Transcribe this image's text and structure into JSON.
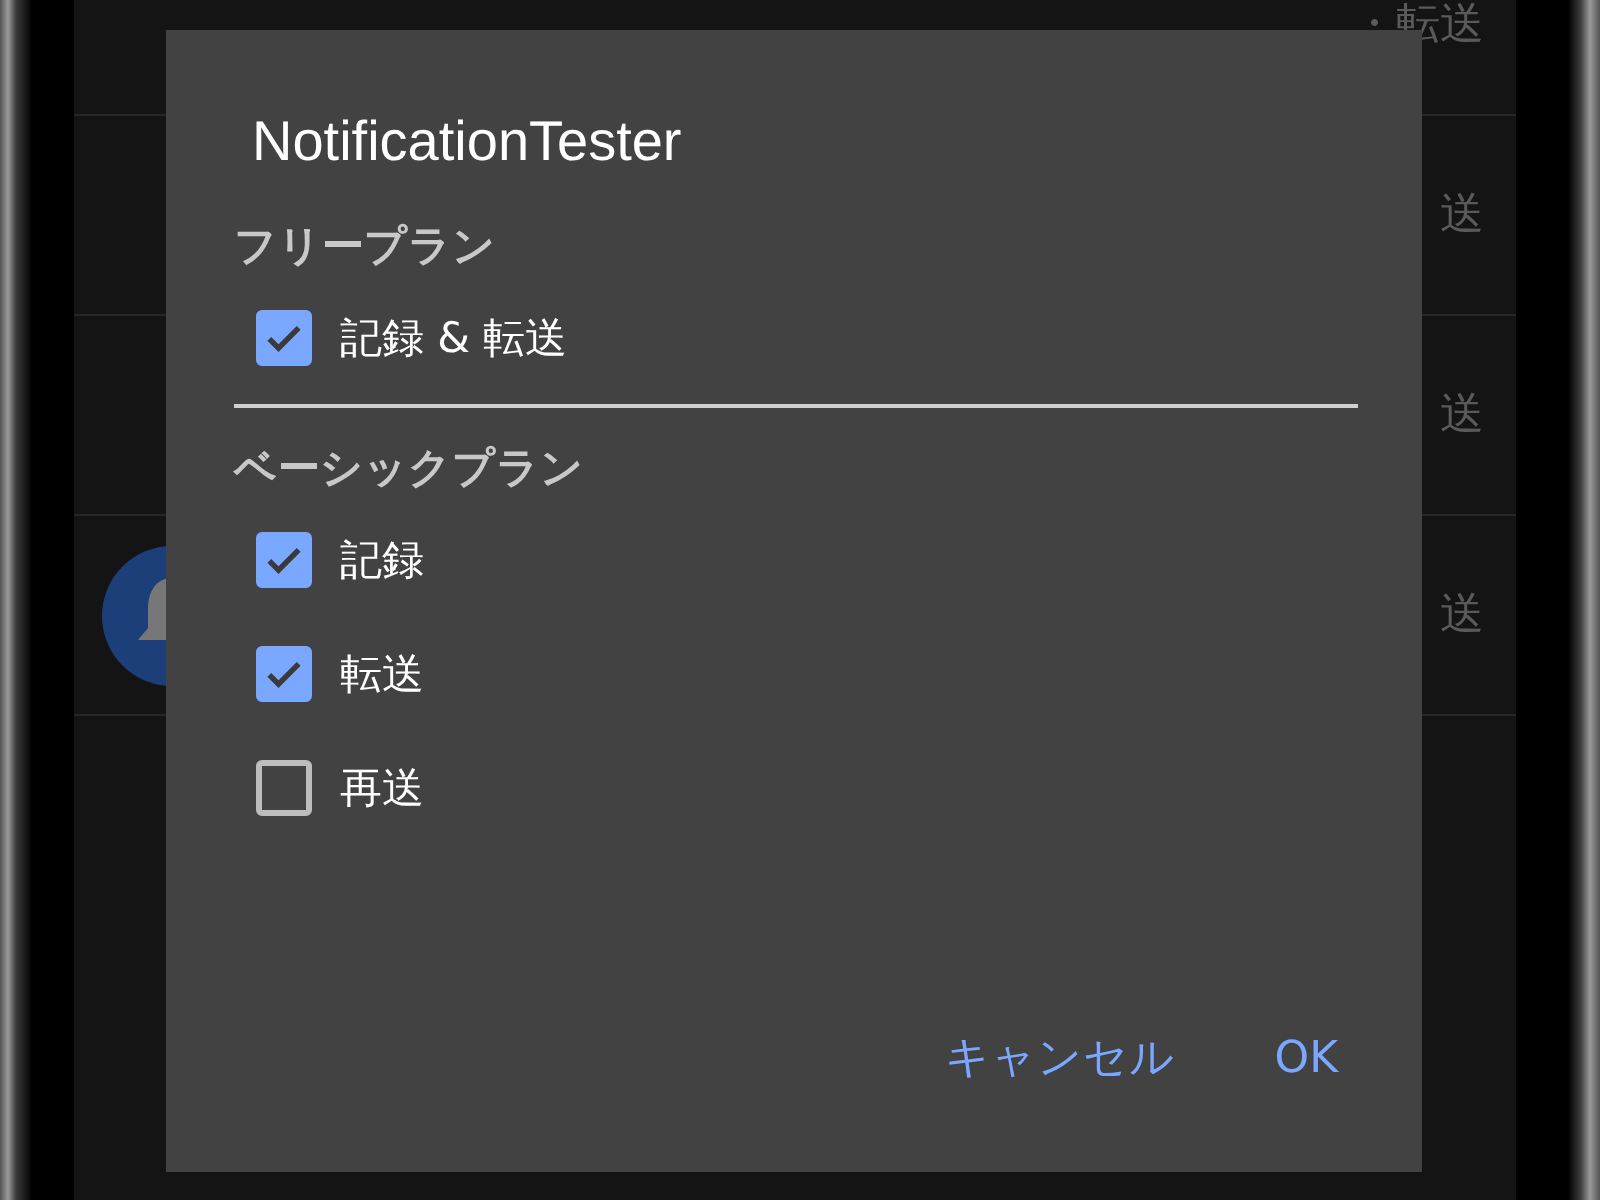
{
  "background_rows": [
    {
      "label": "・転送",
      "icon": false
    },
    {
      "label": "送",
      "icon": false
    },
    {
      "label": "送",
      "icon": false
    },
    {
      "label": "送",
      "icon": true
    }
  ],
  "dialog": {
    "title": "NotificationTester",
    "sections": [
      {
        "heading": "フリープラン",
        "options": [
          {
            "label": "記録 & 転送",
            "checked": true
          }
        ]
      },
      {
        "heading": "ベーシックプラン",
        "options": [
          {
            "label": "記録",
            "checked": true
          },
          {
            "label": "転送",
            "checked": true
          },
          {
            "label": "再送",
            "checked": false
          }
        ]
      }
    ],
    "buttons": [
      "キャンセル",
      "OK"
    ]
  }
}
